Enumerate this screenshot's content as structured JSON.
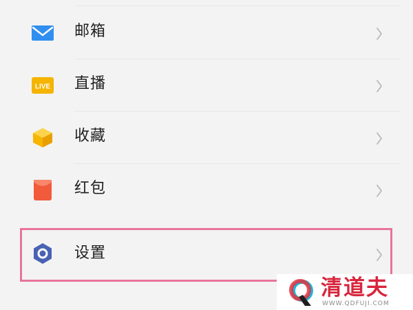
{
  "menu": {
    "items": [
      {
        "label": "邮箱",
        "icon": "envelope-icon"
      },
      {
        "label": "直播",
        "icon": "live-badge-icon",
        "badge_text": "LIVE"
      },
      {
        "label": "收藏",
        "icon": "cube-icon"
      },
      {
        "label": "红包",
        "icon": "red-envelope-icon"
      },
      {
        "label": "设置",
        "icon": "hexagon-gear-icon",
        "highlighted": true
      }
    ]
  },
  "watermark": {
    "brand": "清道夫",
    "url": "WWW.QDFUJI.COM"
  },
  "colors": {
    "background": "#f3f3f3",
    "highlight_border": "#e8749a",
    "mail_icon": "#2f8ef0",
    "live_icon": "#f5b400",
    "collect_icon": "#f7b500",
    "hongbao_icon": "#f15a3b",
    "settings_icon": "#4a62b4",
    "brand_red": "#d7263d"
  }
}
